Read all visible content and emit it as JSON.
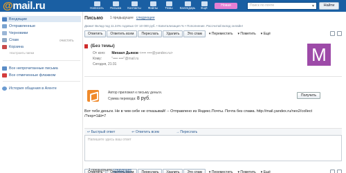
{
  "header": {
    "logo_at": "@",
    "logo_text": "mail.ru",
    "nav": [
      {
        "label": "Написать"
      },
      {
        "label": "Письма"
      },
      {
        "label": "Контакты"
      },
      {
        "label": "Файлы"
      },
      {
        "label": "Темы"
      },
      {
        "label": "Календарь"
      },
      {
        "label": "Ещё"
      }
    ],
    "new_badge": "Новая",
    "search_placeholder": "Поиск по почте",
    "find_button": "Найти"
  },
  "sidebar": {
    "folders": [
      {
        "label": "Входящие",
        "icon": "inbox-icon",
        "active": true
      },
      {
        "label": "Отправленные",
        "icon": "sent-icon"
      },
      {
        "label": "Черновики",
        "icon": "drafts-icon"
      },
      {
        "label": "Спам",
        "icon": "spam-icon",
        "extra": "очистить"
      },
      {
        "label": "Корзина",
        "icon": "trash-icon"
      }
    ],
    "setup_link": "Настроить папки",
    "unread": "Все непрочитанные письма",
    "flagged": "Все отмеченные флажком",
    "agent_history": "История общения в Агенте"
  },
  "main": {
    "title": "Письмо",
    "pager": "1 предыдущее",
    "next": "следующее",
    "promo": "Дюжит   Вклад под 11.24% годовых   От 10 000 руб.  •  Капитализация %  •  Пополнение. Рассчитай вклад онлайн!",
    "toolbar": {
      "reply": "Ответить",
      "reply_all": "Ответить всем",
      "forward": "Переслать",
      "delete": "Удалить",
      "spam": "Это спам",
      "move": "Переместить",
      "mark": "Пометить",
      "more": "Ещё"
    },
    "subject": "(Без темы)",
    "from_label": "От кого:",
    "from_name": "Михаил Дьяков",
    "from_email": "<•••• ••••@yandex.ru>",
    "to_label": "Кому:",
    "to_email": "\"•••• ••••\"@mail.ru",
    "date_label": "Сегодня, 21:31",
    "avatar_letter": "M",
    "money": {
      "line1": "Автор приложил к письму деньги.",
      "amount_label": "Сумма перевода:",
      "amount": "8 руб.",
      "get_button": "Получить"
    },
    "body_line1": "Вот тебе деньги. Не в чем себе не отказывай! -- Отправлено из Яндекс.Почты. Почта без спама. http://mail.yandex.ru/neo2/collect",
    "body_line2": "/?exp=1&t=7",
    "reply_quick": "Быстрый ответ",
    "reply_all_link": "Ответить всем",
    "forward_link": "Переслать",
    "reply_placeholder": "Напишите здесь ваш ответ",
    "footer_pager": "1 предыдущее",
    "footer_next": "следующее"
  }
}
